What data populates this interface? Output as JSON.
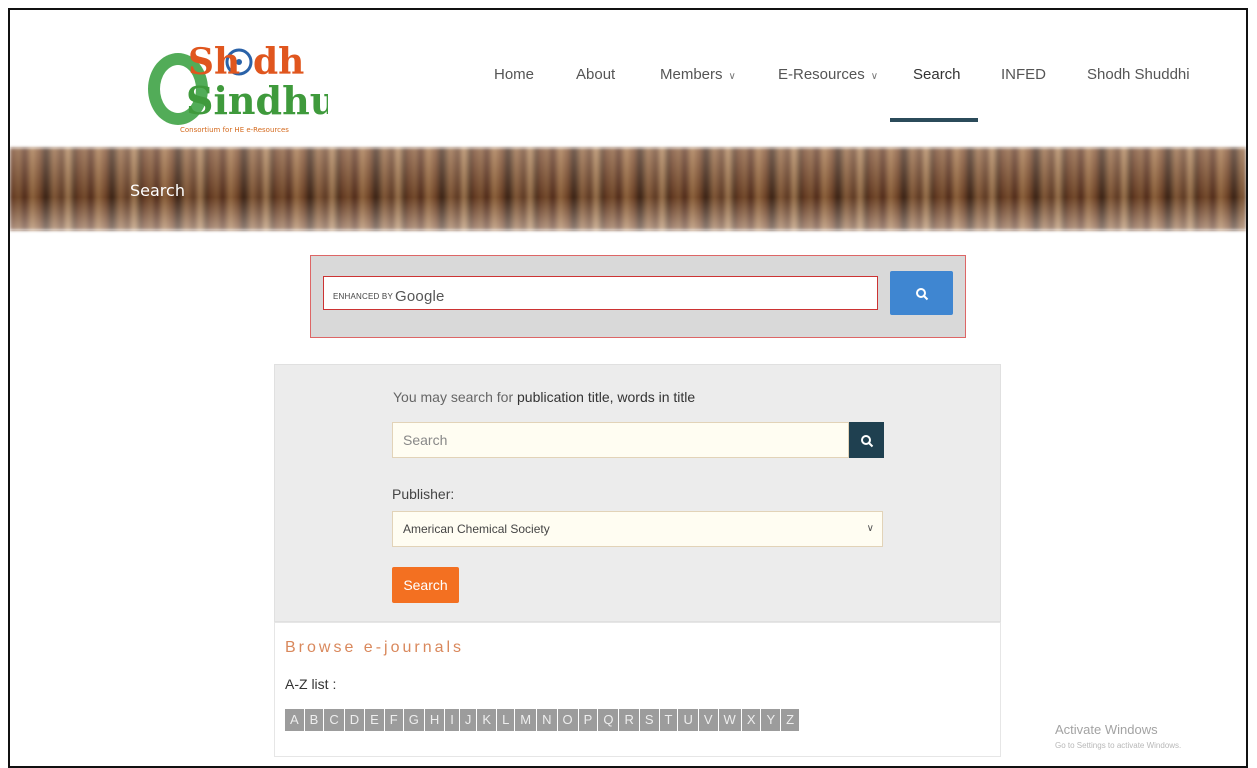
{
  "logo": {
    "alt": "Shodh Sindhu",
    "line1": "Shodh",
    "line2": "Sindhu",
    "tagline": "Consortium for HE e-Resources"
  },
  "nav": {
    "items": [
      {
        "label": "Home"
      },
      {
        "label": "About"
      },
      {
        "label": "Members",
        "dropdown": true
      },
      {
        "label": "E-Resources",
        "dropdown": true
      },
      {
        "label": "Search",
        "active": true
      },
      {
        "label": "INFED"
      },
      {
        "label": "Shodh Shuddhi"
      }
    ]
  },
  "banner": {
    "title": "Search"
  },
  "google_search": {
    "enhanced_by": "ENHANCED BY",
    "brand": "Google",
    "button_icon": "search-icon"
  },
  "journal_search": {
    "hint_prefix": "You may search for ",
    "hint_bold": "publication title, words in title",
    "input_placeholder": "Search",
    "publisher_label": "Publisher:",
    "publisher_selected": "American Chemical Society",
    "submit_label": "Search"
  },
  "browse": {
    "title": "Browse e-journals",
    "az_label": "A-Z list :",
    "letters": [
      "A",
      "B",
      "C",
      "D",
      "E",
      "F",
      "G",
      "H",
      "I",
      "J",
      "K",
      "L",
      "M",
      "N",
      "O",
      "P",
      "Q",
      "R",
      "S",
      "T",
      "U",
      "V",
      "W",
      "X",
      "Y",
      "Z"
    ]
  },
  "watermark": {
    "title": "Activate Windows",
    "subtitle": "Go to Settings to activate Windows."
  },
  "colors": {
    "accent_orange": "#f37021",
    "nav_active": "#2b4b5a",
    "google_button": "#3f86d1",
    "search_button": "#1f4050"
  }
}
